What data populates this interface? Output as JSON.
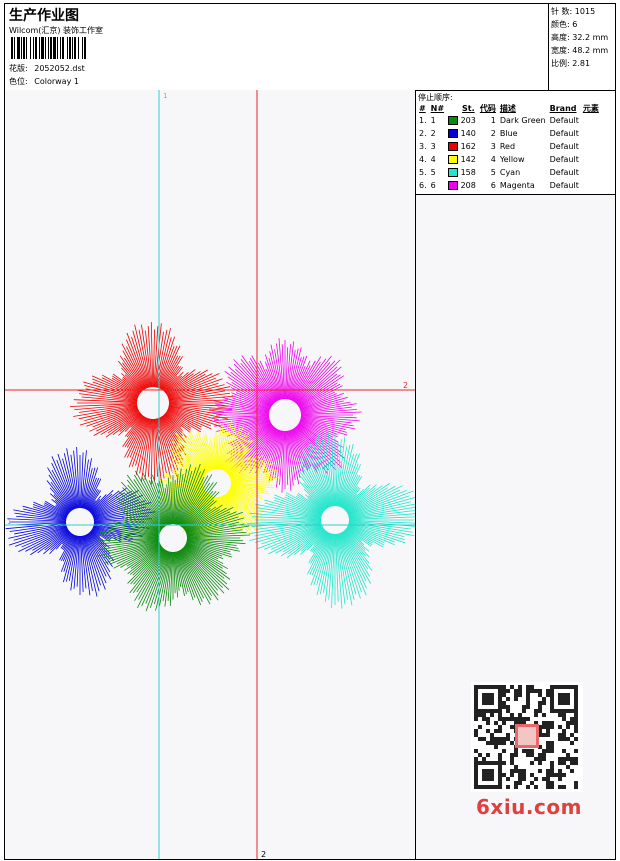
{
  "header": {
    "title": "生产作业图",
    "subtitle": "Wilcom(汇京) 装饰工作室",
    "design_label": "花版:",
    "design_value": "2052052.dst",
    "colorway_label": "色位:",
    "colorway_value": "Colorway 1"
  },
  "stats": [
    {
      "label": "针 数:",
      "value": "1015"
    },
    {
      "label": "颜色:",
      "value": "6"
    },
    {
      "label": "高度:",
      "value": "32.2 mm"
    },
    {
      "label": "宽度:",
      "value": "48.2 mm"
    },
    {
      "label": "比例:",
      "value": "2.81"
    }
  ],
  "legend": {
    "title": "停止顺序:",
    "columns": [
      "#",
      "N#",
      "St.",
      "代码",
      "描述",
      "Brand",
      "元素"
    ],
    "rows": [
      {
        "idx": "1.",
        "n": "1",
        "color": "#0a8a0a",
        "st": "203",
        "code": "1",
        "desc": "Dark Green",
        "brand": "Default"
      },
      {
        "idx": "2.",
        "n": "2",
        "color": "#0000dd",
        "st": "140",
        "code": "2",
        "desc": "Blue",
        "brand": "Default"
      },
      {
        "idx": "3.",
        "n": "3",
        "color": "#ee0000",
        "st": "162",
        "code": "3",
        "desc": "Red",
        "brand": "Default"
      },
      {
        "idx": "4.",
        "n": "4",
        "color": "#ffff00",
        "st": "142",
        "code": "4",
        "desc": "Yellow",
        "brand": "Default"
      },
      {
        "idx": "5.",
        "n": "5",
        "color": "#22e6cc",
        "st": "158",
        "code": "5",
        "desc": "Cyan",
        "brand": "Default"
      },
      {
        "idx": "6.",
        "n": "6",
        "color": "#ee00ee",
        "st": "208",
        "code": "6",
        "desc": "Magenta",
        "brand": "Default"
      }
    ]
  },
  "guides": {
    "vertical_1": "1",
    "vertical_2": "2",
    "horizontal_1": "1",
    "horizontal_2": "2"
  },
  "colors": {
    "guide_1": "#33cccc",
    "guide_2": "#ee2222"
  },
  "watermark": "6xiu.com"
}
